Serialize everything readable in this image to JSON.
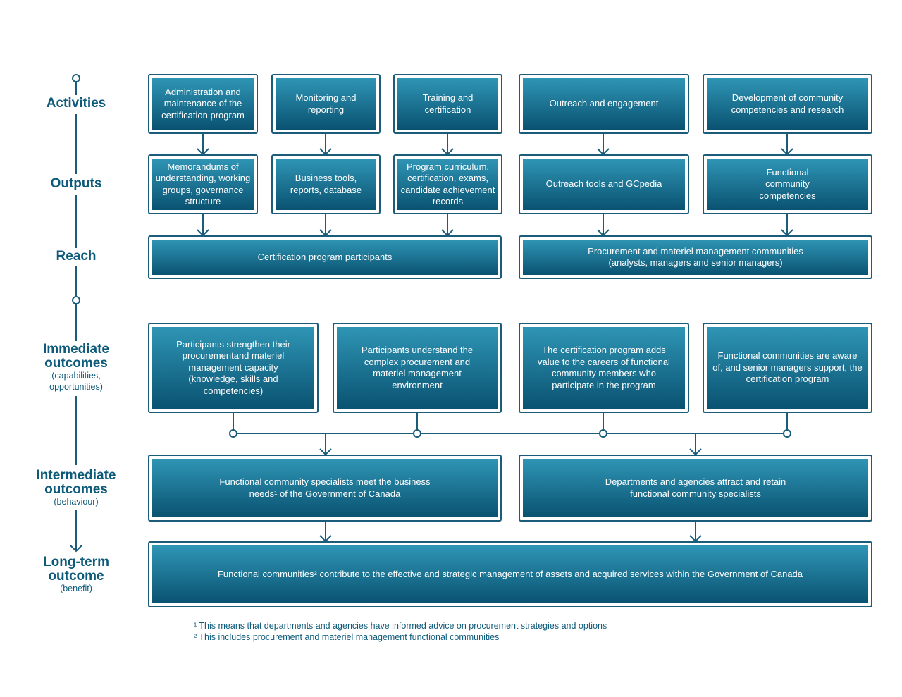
{
  "stages": {
    "activities": {
      "title": "Activities"
    },
    "outputs": {
      "title": "Outputs"
    },
    "reach": {
      "title": "Reach"
    },
    "immediate": {
      "title1": "Immediate",
      "title2": "outcomes",
      "sub1": "(capabilities,",
      "sub2": "opportunities)"
    },
    "intermediate": {
      "title1": "Intermediate",
      "title2": "outcomes",
      "sub1": "(behaviour)"
    },
    "longterm": {
      "title1": "Long-term",
      "title2": "outcome",
      "sub1": "(benefit)"
    }
  },
  "activities": [
    "Administration and maintenance of the certification program",
    "Monitoring and reporting",
    "Training and certification",
    "Outreach and engagement",
    "Development of community competencies and research"
  ],
  "outputs": [
    "Memorandums of understanding, working groups, governance structure",
    "Business tools, reports, database",
    "Program curriculum, certification, exams, candidate achievement records",
    "Outreach tools and GCpedia",
    "Functional community competencies"
  ],
  "reach": [
    "Certification program participants",
    "Procurement and materiel management communities (analysts, managers and senior managers)"
  ],
  "immediate_outcomes": [
    "Participants strengthen their procurementand materiel management capacity (knowledge, skills and competencies)",
    "Participants understand the complex procurement and materiel management environment",
    "The certification program adds value to the careers of functional community members who participate in the program",
    "Functional communities are aware of, and senior managers support, the certification program"
  ],
  "intermediate_outcomes": [
    "Functional community specialists meet the business needs¹ of the Government of Canada",
    "Departments and agencies attract and retain functional community specialists"
  ],
  "longterm_outcome": "Functional communities² contribute to the effective and strategic management of assets and acquired services within the Government of Canada",
  "footnotes": [
    "¹ This means that departments and agencies have informed advice on procurement strategies and options",
    "² This includes procurement and materiel management functional communities"
  ],
  "colors": {
    "line": "#1b5c7b",
    "box_top": "#2f95b5",
    "box_bottom": "#0a5271",
    "label": "#0d5a7a"
  }
}
